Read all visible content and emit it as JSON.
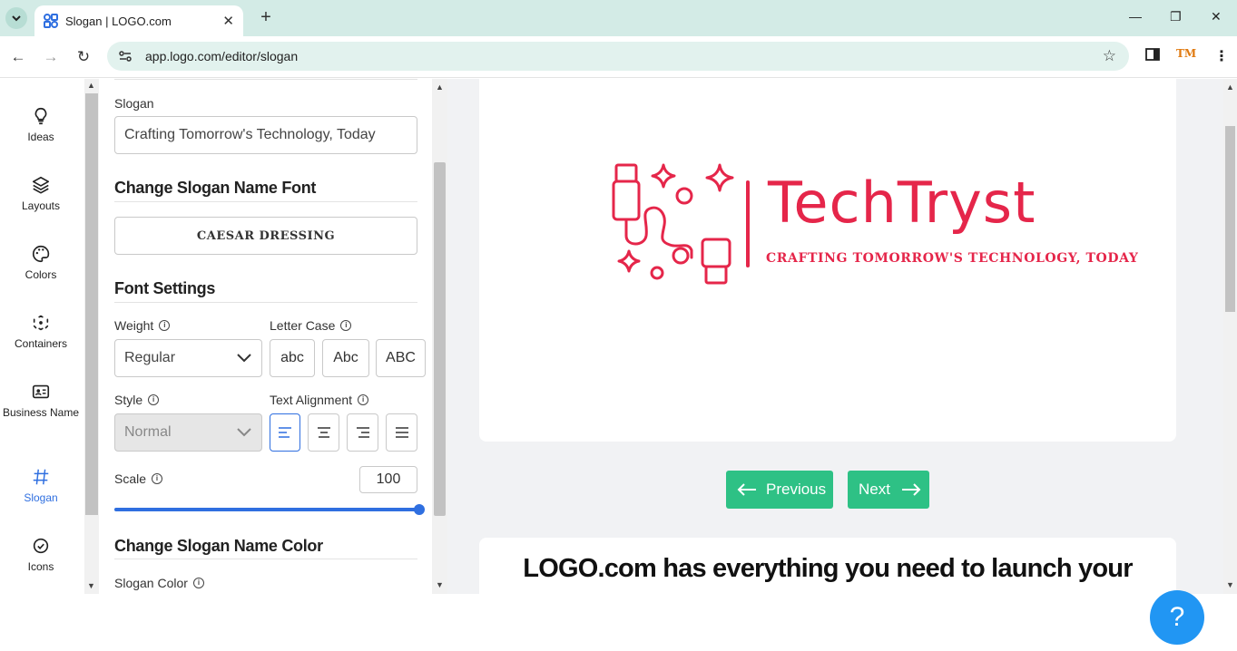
{
  "browser": {
    "tab_title": "Slogan | LOGO.com",
    "url": "app.logo.com/editor/slogan",
    "ext_label": "TM"
  },
  "rail": {
    "items": [
      {
        "label": "Ideas",
        "icon": "lightbulb-icon"
      },
      {
        "label": "Layouts",
        "icon": "layers-icon"
      },
      {
        "label": "Colors",
        "icon": "palette-icon"
      },
      {
        "label": "Containers",
        "icon": "containers-icon"
      },
      {
        "label": "Business Name",
        "icon": "id-card-icon"
      },
      {
        "label": "Slogan",
        "icon": "hash-icon"
      },
      {
        "label": "Icons",
        "icon": "check-circle-icon"
      }
    ],
    "active": "Slogan"
  },
  "panel": {
    "slogan_label": "Slogan",
    "slogan_value": "Crafting Tomorrow's Technology, Today",
    "font_heading": "Change Slogan Name Font",
    "font_name": "CAESAR DRESSING",
    "font_settings_heading": "Font Settings",
    "weight_label": "Weight",
    "weight_value": "Regular",
    "letter_case_label": "Letter Case",
    "letter_case_options": [
      "abc",
      "Abc",
      "ABC"
    ],
    "style_label": "Style",
    "style_value": "Normal",
    "text_alignment_label": "Text Alignment",
    "scale_label": "Scale",
    "scale_value": "100",
    "scale_fraction": 1.0,
    "color_heading": "Change Slogan Name Color",
    "slogan_color_label": "Slogan Color"
  },
  "preview": {
    "brand_name": "TechTryst",
    "brand_slogan": "CRAFTING TOMORROW'S TECHNOLOGY, TODAY",
    "brand_color": "#e5264a",
    "previous_label": "Previous",
    "next_label": "Next",
    "promo_text": "LOGO.com has everything you need to launch your",
    "help_label": "?"
  },
  "colors": {
    "accent_green": "#2ec185",
    "active_blue": "#2f6fe0",
    "help_blue": "#2196f3"
  }
}
